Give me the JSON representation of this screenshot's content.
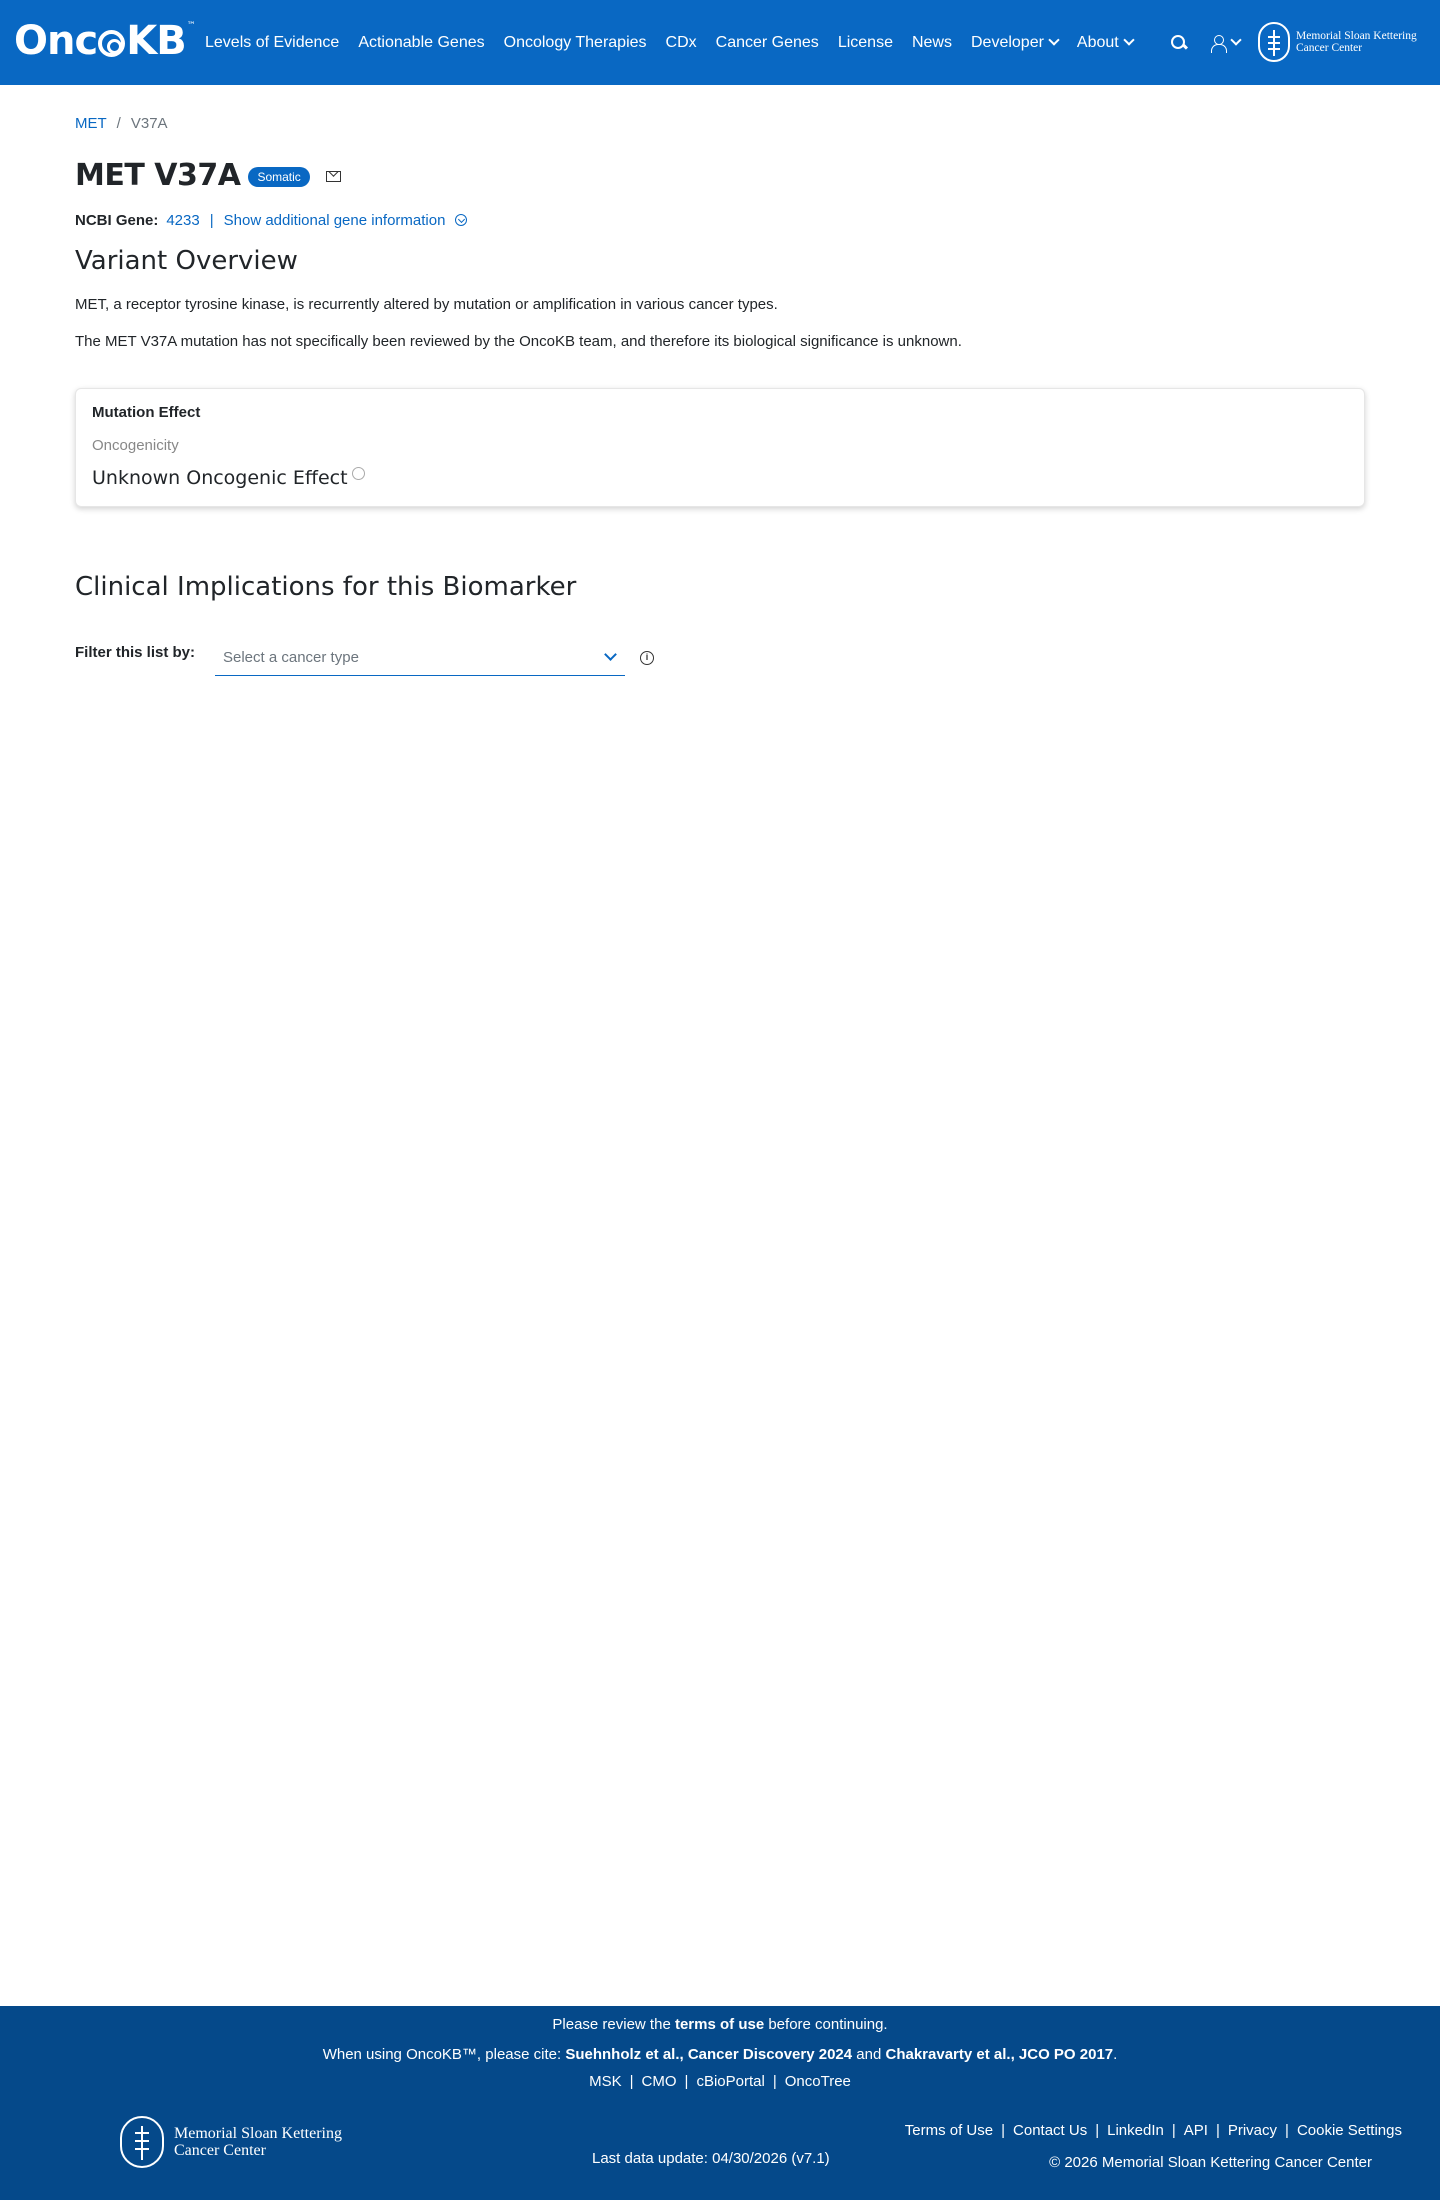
{
  "header": {
    "brand": "OncKB",
    "brand_prefix": "Onc",
    "brand_suffix": "KB",
    "brand_tm": "™",
    "nav": [
      {
        "label": "Levels of Evidence"
      },
      {
        "label": "Actionable Genes"
      },
      {
        "label": "Oncology Therapies"
      },
      {
        "label": "CDx"
      },
      {
        "label": "Cancer Genes"
      },
      {
        "label": "License"
      },
      {
        "label": "News"
      },
      {
        "label": "Developer"
      },
      {
        "label": "About"
      }
    ],
    "msk_line1": "Memorial Sloan Kettering",
    "msk_line2": "Cancer Center",
    "bg_color": "#0968c3"
  },
  "breadcrumb": {
    "gene": "MET",
    "separator": "/",
    "current": "V37A"
  },
  "variant": {
    "title": "MET V37A",
    "badge": "Somatic",
    "ncbi_label": "NCBI Gene:",
    "ncbi_id": "4233",
    "gene_sep": "|",
    "more_info": "Show additional gene information"
  },
  "overview": {
    "title": "Variant Overview",
    "para1": "MET, a receptor tyrosine kinase, is recurrently altered by mutation or amplification in various cancer types.",
    "para2": "The MET V37A mutation has not specifically been reviewed by the OncoKB team, and therefore its biological significance is unknown."
  },
  "mutation_effect": {
    "heading": "Mutation Effect",
    "sub": "Oncogenicity",
    "value": "Unknown Oncogenic Effect"
  },
  "clinical": {
    "title": "Clinical Implications for this Biomarker",
    "filter_label": "Filter this list by:",
    "filter_placeholder": "Select a cancer type",
    "info_glyph": "i"
  },
  "footer": {
    "review_prefix": "Please review the",
    "review_link": "terms of use",
    "review_suffix": "before continuing.",
    "cite_prefix": "When using OncoKB™, please cite:",
    "cite_1": "Suehnholz et al., Cancer Discovery 2024",
    "cite_and": "and",
    "cite_2": "Chakravarty et al., JCO PO 2017",
    "cite_end": ".",
    "links": [
      "MSK",
      "CMO",
      "cBioPortal",
      "OncoTree"
    ],
    "pipe": "|",
    "msk_line1": "Memorial Sloan Kettering",
    "msk_line2": "Cancer Center",
    "last_update": "Last data update: 04/30/2026 (v7.1)",
    "right_links": [
      "Terms of Use",
      "Contact Us",
      "LinkedIn",
      "API",
      "Privacy",
      "Cookie Settings"
    ],
    "copyright": "© 2026 Memorial Sloan Kettering Cancer Center",
    "bg_color": "#05498a"
  }
}
